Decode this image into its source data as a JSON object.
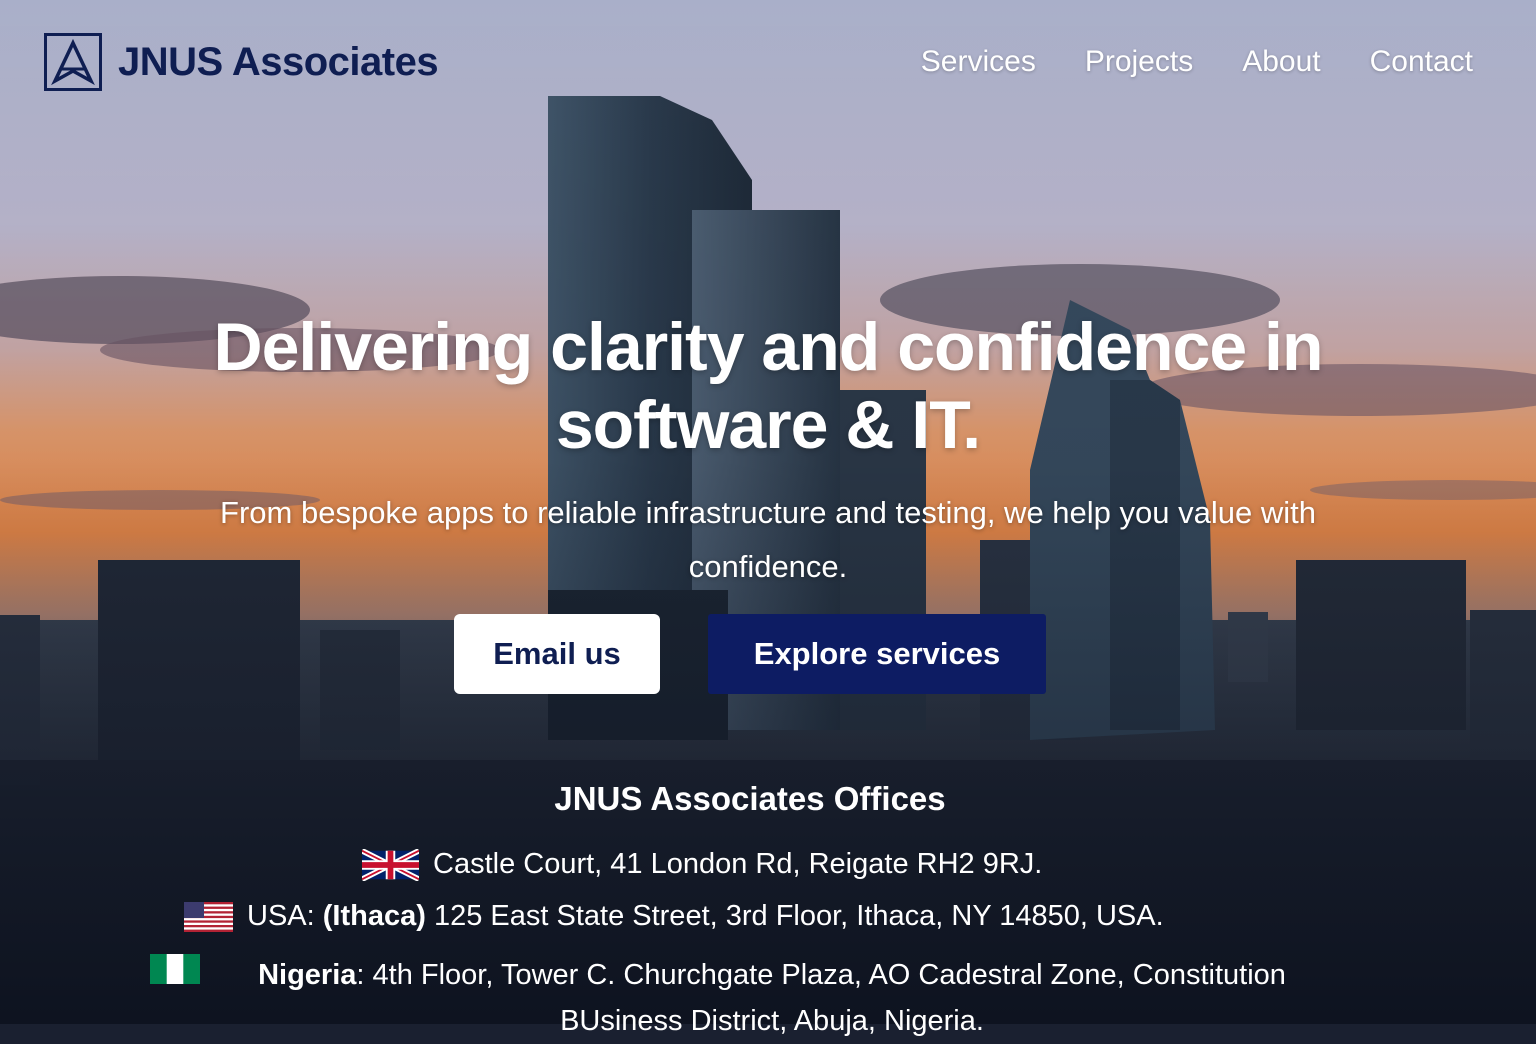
{
  "brand": {
    "name": "JNUS Associates",
    "logo_icon": "triangle-logo-icon",
    "color": "#0f1e52"
  },
  "nav": {
    "items": [
      "Services",
      "Projects",
      "About",
      "Contact"
    ]
  },
  "hero": {
    "headline": "Delivering clarity and confidence in software & IT.",
    "subheadline": "From bespoke apps to reliable infrastructure and testing, we help you value with confidence."
  },
  "cta": {
    "email_label": "Email us",
    "explore_label": "Explore services",
    "explore_color": "#0d1c63"
  },
  "offices": {
    "title": "JNUS Associates Offices",
    "uk": {
      "flag_icon": "uk-flag-icon",
      "address": "Castle Court, 41 London Rd, Reigate RH2 9RJ."
    },
    "usa": {
      "flag_icon": "us-flag-icon",
      "country": "USA:",
      "city": "(Ithaca)",
      "address": "125 East State Street, 3rd Floor, Ithaca, NY 14850, USA."
    },
    "nigeria": {
      "flag_icon": "nigeria-flag-icon",
      "country": "Nigeria",
      "address": ": 4th Floor, Tower C. Churchgate Plaza, AO Cadestral Zone, Constitution BUsiness District, Abuja, Nigeria."
    }
  }
}
